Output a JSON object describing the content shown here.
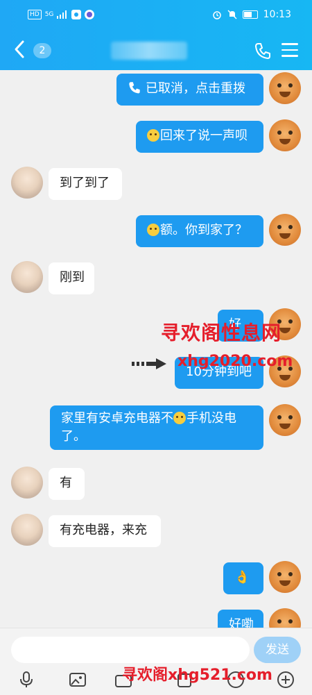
{
  "status_bar": {
    "left_chips": [
      "HD",
      "5G"
    ],
    "time": "10:13"
  },
  "header": {
    "unread_count": "2"
  },
  "messages": [
    {
      "side": "me",
      "text": "已取消，点击重拨",
      "icon": "phone-icon"
    },
    {
      "side": "me",
      "text": "回来了说一声呗",
      "icon": "emoji-icon"
    },
    {
      "side": "them",
      "text": "到了到了"
    },
    {
      "side": "me",
      "text": "额。你到家了？",
      "icon": "emoji-icon"
    },
    {
      "side": "them",
      "text": "刚到"
    },
    {
      "side": "me",
      "text": "好"
    },
    {
      "side": "me",
      "text": "10分钟到吧"
    },
    {
      "side": "me",
      "text_1": "家里有安卓充电器不",
      "text_2": "手机没电",
      "text_3": "了。"
    },
    {
      "side": "them",
      "text": "有"
    },
    {
      "side": "them",
      "text": "有充电器，来充"
    },
    {
      "side": "me",
      "text": "👌"
    },
    {
      "side": "me",
      "text": "好嘞"
    }
  ],
  "watermark": {
    "line1": "寻欢阁性息网",
    "line2": "xhg2020.com",
    "line3": "寻欢阁xhg521.com"
  },
  "input": {
    "placeholder": "",
    "send_label": "发送"
  },
  "colors": {
    "header": "#1fa8f5",
    "bubble_me": "#1e9bf0",
    "bubble_them": "#ffffff",
    "watermark": "#e51e2b"
  }
}
